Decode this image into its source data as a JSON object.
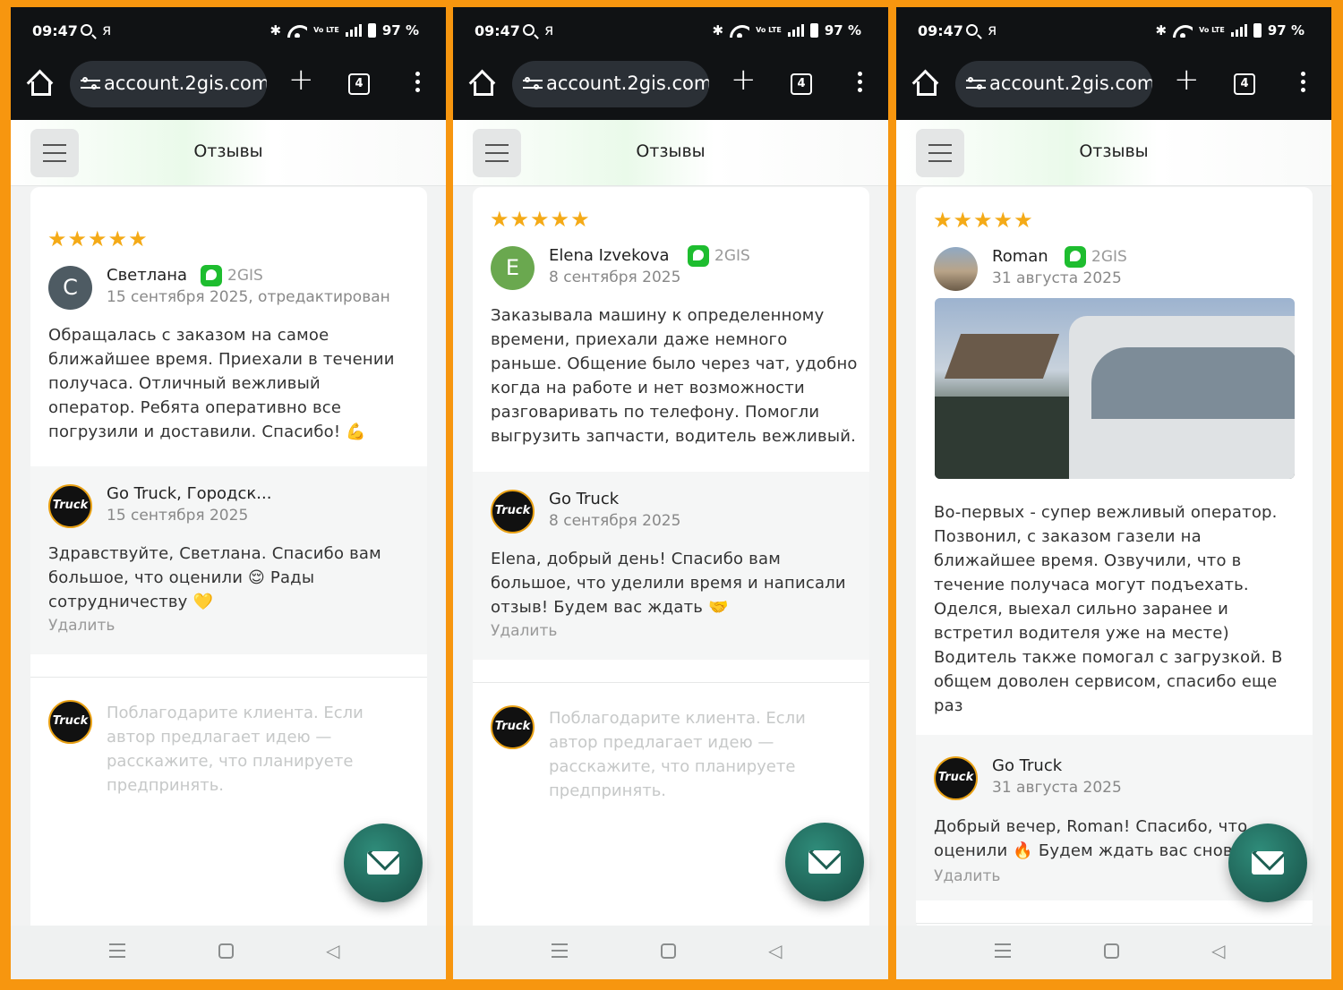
{
  "status": {
    "time": "09:47",
    "ya": "я",
    "battery": "97 %",
    "volte": "Vo LTE"
  },
  "browser": {
    "url": "account.2gis.com",
    "tabs_count": "4"
  },
  "page_title": "Отзывы",
  "panels": [
    {
      "review": {
        "stars": "★★★★★",
        "author": "Светлана",
        "avatar_letter": "С",
        "source": "2GIS",
        "date": "15 сентября 2025, отредактирован",
        "text": "Обращалась с заказом на самое ближайшее время. Приехали в течении получаса. Отличный вежливый оператор. Ребята оперативно все погрузили и доставили. Спасибо! 💪"
      },
      "reply": {
        "company": "Go Truck, Городск...",
        "date": "15 сентября 2025",
        "text": "Здравствуйте, Светлана. Спасибо вам большое, что оценили 😌 Рады сотрудничеству 💛",
        "delete_label": "Удалить"
      },
      "reply_placeholder": "Поблагодарите клиента. Если автор предлагает идею — расскажите, что планируете предпринять."
    },
    {
      "review": {
        "stars": "★★★★★",
        "author": "Elena Izvekova",
        "avatar_letter": "E",
        "source": "2GIS",
        "date": "8 сентября 2025",
        "text": "Заказывала машину к определенному времени, приехали даже немного раньше. Общение было через чат, удобно когда на работе и нет возможности разговаривать по телефону. Помогли выгрузить запчасти, водитель вежливый."
      },
      "reply": {
        "company": "Go Truck",
        "date": "8 сентября 2025",
        "text": "Elena, добрый день! Спасибо вам большое, что уделили время и написали отзыв! Будем вас ждать 🤝",
        "delete_label": "Удалить"
      },
      "reply_placeholder": "Поблагодарите клиента. Если автор предлагает идею — расскажите, что планируете предпринять."
    },
    {
      "review": {
        "stars": "★★★★★",
        "author": "Roman",
        "source": "2GIS",
        "date": "31 августа 2025",
        "text": "Во-первых - супер вежливый оператор. Позвонил, с заказом газели на ближайшее время. Озвучили, что в течение получаса могут подъехать. Оделся, выехал сильно заранее и встретил водителя уже на месте) Водитель также помогал с загрузкой. В общем доволен сервисом, спасибо еще раз"
      },
      "reply": {
        "company": "Go Truck",
        "date": "31 августа 2025",
        "text": "Добрый вечер, Roman! Спасибо, что оценили 🔥 Будем ждать вас снова",
        "delete_label": "Удалить"
      }
    }
  ],
  "logo_text": "Truck",
  "colors": {
    "frame": "#f7960f",
    "star": "#f4aa17",
    "badge": "#1ebd2f",
    "fab": "#1f6a5c"
  }
}
